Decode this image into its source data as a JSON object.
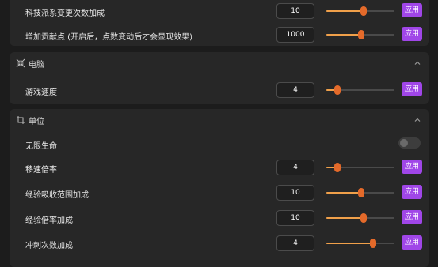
{
  "top_section": {
    "rows": [
      {
        "label": "科技派系变更次数加成",
        "value": "10",
        "slider_percent": 55,
        "apply_label": "应用"
      },
      {
        "label": "增加贡献点 (开启后，点数变动后才会显现效果)",
        "value": "1000",
        "slider_percent": 51,
        "apply_label": "应用"
      }
    ]
  },
  "computer_section": {
    "title": "电脑",
    "icon": "compress-arrows-icon",
    "rows": [
      {
        "label": "游戏速度",
        "value": "4",
        "slider_percent": 16,
        "apply_label": "应用"
      }
    ]
  },
  "unit_section": {
    "title": "单位",
    "icon": "crop-icon",
    "toggle": {
      "label": "无限生命",
      "on": false
    },
    "rows": [
      {
        "label": "移速倍率",
        "value": "4",
        "slider_percent": 16,
        "apply_label": "应用"
      },
      {
        "label": "经验吸收范围加成",
        "value": "10",
        "slider_percent": 51,
        "apply_label": "应用"
      },
      {
        "label": "经验倍率加成",
        "value": "10",
        "slider_percent": 55,
        "apply_label": "应用"
      },
      {
        "label": "冲刺次数加成",
        "value": "4",
        "slider_percent": 69,
        "apply_label": "应用"
      }
    ]
  },
  "colors": {
    "accent": "#a046e8",
    "slider_fill": "#f0a04a",
    "slider_thumb": "#e46a2a"
  }
}
